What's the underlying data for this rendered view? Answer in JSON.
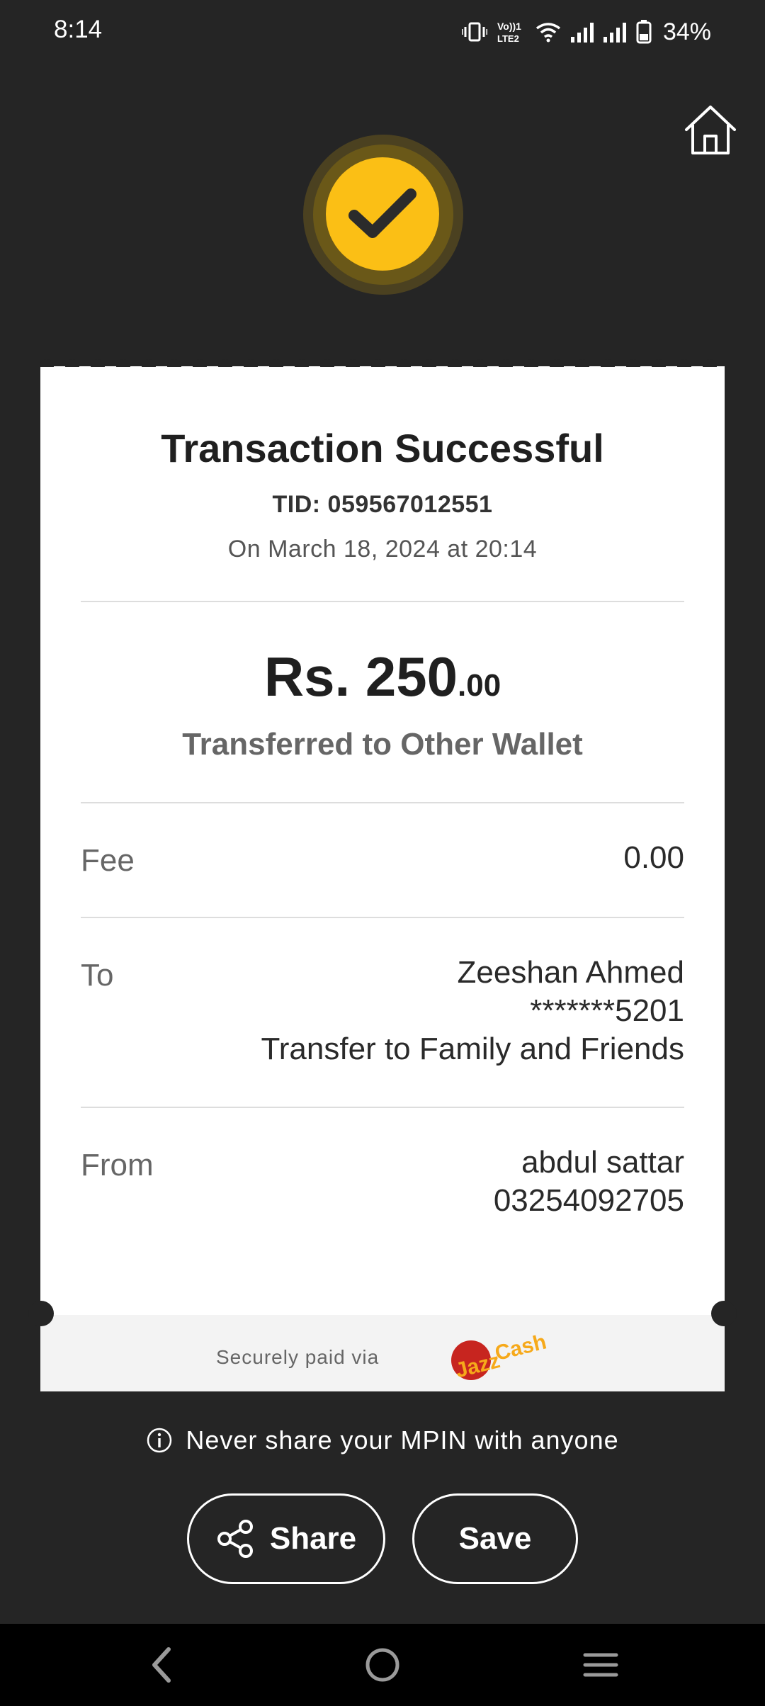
{
  "status_bar": {
    "time": "8:14",
    "battery": "34%",
    "network_label": "Vo)) 1 LTE2",
    "icons": [
      "vibrate-icon",
      "volte-icon",
      "wifi-icon",
      "signal-icon",
      "signal-icon",
      "battery-icon"
    ]
  },
  "header": {
    "home_icon": "home-icon"
  },
  "status": {
    "icon": "check-icon",
    "color": "#fbbf15"
  },
  "receipt": {
    "title": "Transaction Successful",
    "tid": "TID: 059567012551",
    "date": "On March 18, 2024 at 20:14",
    "amount_main": "Rs. 250",
    "amount_decimals": ".00",
    "description": "Transferred to Other Wallet",
    "fee": {
      "label": "Fee",
      "value": "0.00"
    },
    "to": {
      "label": "To",
      "name": "Zeeshan Ahmed",
      "account": "*******5201",
      "purpose": "Transfer to Family and Friends"
    },
    "from": {
      "label": "From",
      "name": "abdul sattar",
      "account": "03254092705"
    },
    "paid_via": "Securely paid via",
    "brand_logo_text": "JazzCash"
  },
  "notice": {
    "icon": "info-icon",
    "text": "Never share your MPIN with anyone"
  },
  "actions": {
    "share": "Share",
    "save": "Save"
  },
  "nav": {
    "items": [
      "back-icon",
      "home-circle-icon",
      "menu-icon"
    ]
  }
}
